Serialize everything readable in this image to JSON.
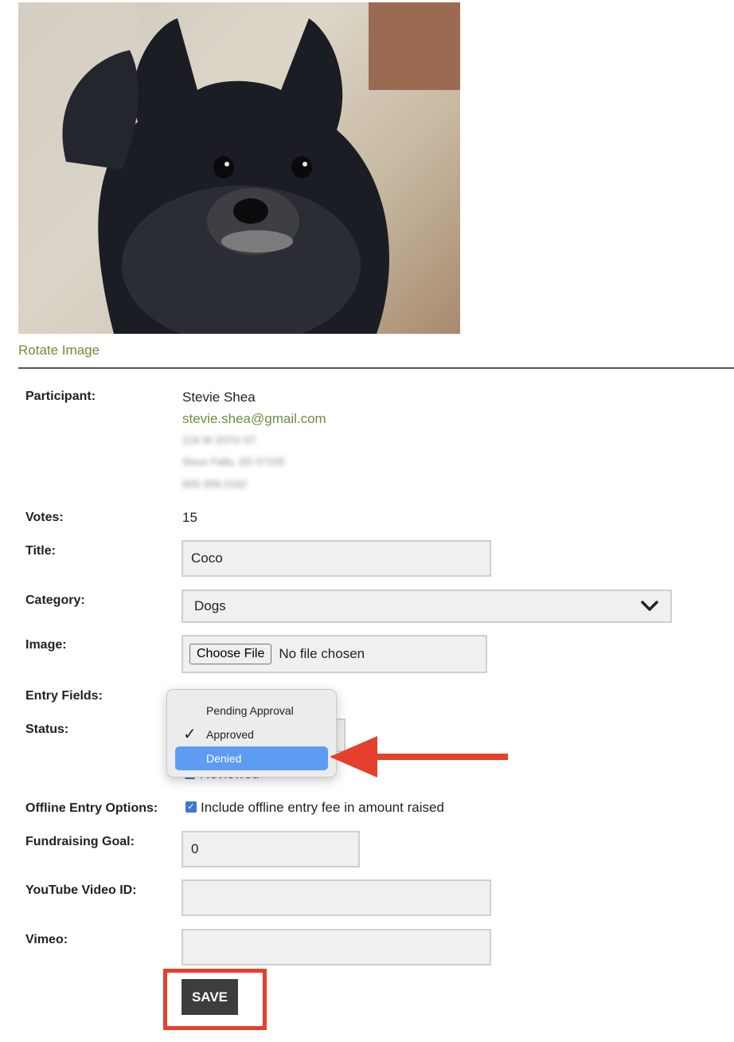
{
  "image": {
    "rotate_label": "Rotate Image"
  },
  "participant": {
    "label": "Participant:",
    "name": "Stevie Shea",
    "email": "stevie.shea@gmail.com",
    "address_line1": "216 W 20TH ST",
    "address_line2": "Sioux Falls, SD 57105",
    "phone": "605-359-2162"
  },
  "votes": {
    "label": "Votes:",
    "value": "15"
  },
  "title": {
    "label": "Title:",
    "value": "Coco"
  },
  "category": {
    "label": "Category:",
    "value": "Dogs"
  },
  "image_field": {
    "label": "Image:",
    "button": "Choose File",
    "status": "No file chosen"
  },
  "entry_fields": {
    "label": "Entry Fields:"
  },
  "status": {
    "label": "Status:",
    "options": [
      "Pending Approval",
      "Approved",
      "Denied"
    ],
    "checked": "Approved",
    "hovered": "Denied",
    "reviewed_label": "Reviewed"
  },
  "offline": {
    "label": "Offline Entry Options:",
    "checkbox_label": "Include offline entry fee in amount raised"
  },
  "fundraising": {
    "label": "Fundraising Goal:",
    "value": "0"
  },
  "youtube": {
    "label": "YouTube Video ID:",
    "value": ""
  },
  "vimeo": {
    "label": "Vimeo:",
    "value": ""
  },
  "save": {
    "label": "SAVE"
  },
  "colors": {
    "link": "#6f8d3b",
    "annotation": "#e5402b",
    "highlight": "#5e9cf3",
    "button": "#3d3d3d"
  }
}
